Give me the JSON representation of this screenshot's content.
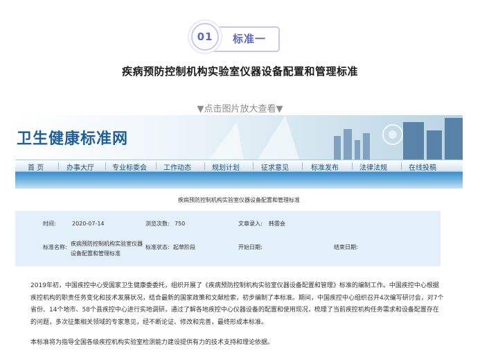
{
  "badge": {
    "number": "01",
    "label": "标准一"
  },
  "title": "疾病预防控制机构实验室仪器设备配置和管理标准",
  "hint": "▼点击图片放大查看▼",
  "site": {
    "logo": "卫生健康标准网",
    "nav": [
      "首 页",
      "办事大厅",
      "专业标委会",
      "工作动态",
      "规划计划",
      "征求意见",
      "标准发布",
      "法律法规",
      "在线投稿"
    ]
  },
  "document": {
    "title": "疾病预防控制机构实验室仪器设备配置和管理标准",
    "meta": {
      "time_label": "时间:",
      "time_value": "2020-07-14",
      "views_label": "浏览次数:",
      "views_value": "750",
      "entry_label": "文章录入:",
      "entry_value": "韩雲会",
      "std_name_label": "标准名称:",
      "std_name_value": "疾病预防控制机构实验室仪器设备配置和管理标准",
      "std_status_label": "标准状态:",
      "std_status_value": "起草阶段",
      "start_label": "开始日期:",
      "end_label": "结束日期:"
    },
    "paragraph1": "2019年初，中国疾控中心受国家卫生健康委委托，组织开展了《疾病预防控制机构实验室仪器设备配置和管理》标准的编制工作。中国疾控中心根据疾控机构的职责任务变化和技术发展状况，结合最新的国家政策和文献检索，初步编制了本标准。期间，中国疾控中心组织召开4次编写研讨会，对7个省份、14个地市、58个县疾控中心进行实地调研，通过了解各地疾控中心仪器设备的配置和使用现况，梳理了当前疾控机构任务需求和设备配置存在的问题，多次征集相关领域的专家意见，经不断论证、修改和完善，最终形成本标准。",
    "paragraph2": "本标准将为指导全国各级疾控机构实验室检测能力建设提供有力的技术支持和理论依据。"
  }
}
